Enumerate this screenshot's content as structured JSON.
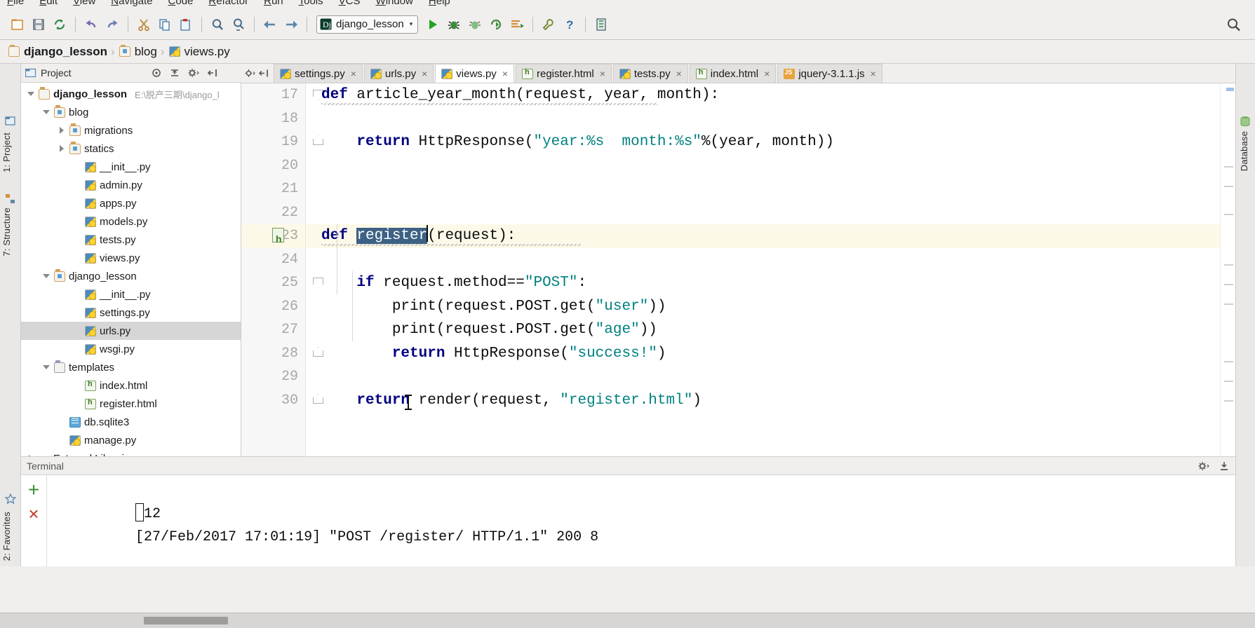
{
  "window": {
    "ide": "PyCharm",
    "accent_blue": "#3d6185",
    "current_line_bg": "#fcf9e8"
  },
  "menubar": {
    "items": [
      "File",
      "Edit",
      "View",
      "Navigate",
      "Code",
      "Refactor",
      "Run",
      "Tools",
      "VCS",
      "Window",
      "Help"
    ]
  },
  "toolbar": {
    "run_config": "django_lesson",
    "run_config_caret": "▾",
    "icons": [
      "open-folder-icon",
      "save-all-icon",
      "sync-icon",
      "undo-icon",
      "redo-icon",
      "cut-icon",
      "copy-icon",
      "paste-icon",
      "find-icon",
      "replace-icon",
      "back-icon",
      "forward-icon"
    ],
    "run_icons": [
      "run-icon",
      "debug-icon",
      "coverage-icon",
      "profile-icon",
      "run-with-console-icon",
      "settings-wrench-icon",
      "help-icon",
      "project-structure-icon"
    ],
    "search_everywhere": "search-everywhere-icon"
  },
  "breadcrumb": {
    "items": [
      {
        "label": "django_lesson",
        "icon": "folder-icon"
      },
      {
        "label": "blog",
        "icon": "module-folder-icon"
      },
      {
        "label": "views.py",
        "icon": "python-file-icon"
      }
    ],
    "separator": "›"
  },
  "left_strip": {
    "tabs": [
      "1: Project",
      "7: Structure",
      "2: Favorites"
    ]
  },
  "right_strip": {
    "tabs": [
      "Database"
    ]
  },
  "project_panel": {
    "title": "Project",
    "caret": "▾",
    "toolbar_icons": [
      "target-icon",
      "collapse-all-icon",
      "gear-icon",
      "hide-icon"
    ],
    "tree": [
      {
        "label": "django_lesson",
        "icon": "folder-icon",
        "depth": 0,
        "arrow": "down",
        "bold": true,
        "path": "E:\\脱产三期\\django_l",
        "selected": false
      },
      {
        "label": "blog",
        "icon": "module-folder-icon",
        "depth": 1,
        "arrow": "down",
        "bold": false,
        "selected": false
      },
      {
        "label": "migrations",
        "icon": "module-folder-icon",
        "depth": 2,
        "arrow": "right",
        "bold": false,
        "selected": false
      },
      {
        "label": "statics",
        "icon": "module-folder-icon",
        "depth": 2,
        "arrow": "right",
        "bold": false,
        "selected": false
      },
      {
        "label": "__init__.py",
        "icon": "python-file-icon",
        "depth": 3,
        "arrow": "none",
        "bold": false,
        "selected": false
      },
      {
        "label": "admin.py",
        "icon": "python-file-icon",
        "depth": 3,
        "arrow": "none",
        "bold": false,
        "selected": false
      },
      {
        "label": "apps.py",
        "icon": "python-file-icon",
        "depth": 3,
        "arrow": "none",
        "bold": false,
        "selected": false
      },
      {
        "label": "models.py",
        "icon": "python-file-icon",
        "depth": 3,
        "arrow": "none",
        "bold": false,
        "selected": false
      },
      {
        "label": "tests.py",
        "icon": "python-file-icon",
        "depth": 3,
        "arrow": "none",
        "bold": false,
        "selected": false
      },
      {
        "label": "views.py",
        "icon": "python-file-icon",
        "depth": 3,
        "arrow": "none",
        "bold": false,
        "selected": false
      },
      {
        "label": "django_lesson",
        "icon": "module-folder-icon",
        "depth": 1,
        "arrow": "down",
        "bold": false,
        "selected": false
      },
      {
        "label": "__init__.py",
        "icon": "python-file-icon",
        "depth": 3,
        "arrow": "none",
        "bold": false,
        "selected": false
      },
      {
        "label": "settings.py",
        "icon": "python-file-icon",
        "depth": 3,
        "arrow": "none",
        "bold": false,
        "selected": false
      },
      {
        "label": "urls.py",
        "icon": "python-file-icon",
        "depth": 3,
        "arrow": "none",
        "bold": false,
        "selected": true
      },
      {
        "label": "wsgi.py",
        "icon": "python-file-icon",
        "depth": 3,
        "arrow": "none",
        "bold": false,
        "selected": false
      },
      {
        "label": "templates",
        "icon": "plain-folder-icon",
        "depth": 1,
        "arrow": "down",
        "bold": false,
        "selected": false
      },
      {
        "label": "index.html",
        "icon": "html-file-icon",
        "depth": 3,
        "arrow": "none",
        "bold": false,
        "selected": false
      },
      {
        "label": "register.html",
        "icon": "html-file-icon",
        "depth": 3,
        "arrow": "none",
        "bold": false,
        "selected": false
      },
      {
        "label": "db.sqlite3",
        "icon": "database-file-icon",
        "depth": 2,
        "arrow": "none",
        "bold": false,
        "selected": false
      },
      {
        "label": "manage.py",
        "icon": "python-file-icon",
        "depth": 2,
        "arrow": "none",
        "bold": false,
        "selected": false
      },
      {
        "label": "External Libraries",
        "icon": "library-icon",
        "depth": 0,
        "arrow": "right",
        "bold": false,
        "selected": false
      }
    ]
  },
  "editor": {
    "tabs": [
      {
        "label": "settings.py",
        "icon": "python-file-icon",
        "active": false,
        "close": "×"
      },
      {
        "label": "urls.py",
        "icon": "python-file-icon",
        "active": false,
        "close": "×"
      },
      {
        "label": "views.py",
        "icon": "python-file-icon",
        "active": true,
        "close": "×"
      },
      {
        "label": "register.html",
        "icon": "html-file-icon",
        "active": false,
        "close": "×"
      },
      {
        "label": "tests.py",
        "icon": "python-file-icon",
        "active": false,
        "close": "×"
      },
      {
        "label": "index.html",
        "icon": "html-file-icon",
        "active": false,
        "close": "×"
      },
      {
        "label": "jquery-3.1.1.js",
        "icon": "js-file-icon",
        "active": false,
        "close": "×"
      }
    ],
    "file": "views.py",
    "first_visible_line": 17,
    "current_line": 23,
    "selected_text": "register",
    "lines": [
      {
        "num": 17,
        "fold": "open",
        "current": false,
        "tokens": [
          {
            "t": "def ",
            "c": "kw"
          },
          {
            "t": "article_year_month(request, year, month):",
            "c": "plain"
          }
        ]
      },
      {
        "num": 18,
        "fold": "none",
        "current": false,
        "tokens": []
      },
      {
        "num": 19,
        "fold": "end",
        "current": false,
        "tokens": [
          {
            "t": "    ",
            "c": "plain"
          },
          {
            "t": "return ",
            "c": "kw"
          },
          {
            "t": "HttpResponse(",
            "c": "plain"
          },
          {
            "t": "\"year:%s  month:%s\"",
            "c": "str"
          },
          {
            "t": "%(year, month))",
            "c": "plain"
          }
        ]
      },
      {
        "num": 20,
        "fold": "none",
        "current": false,
        "tokens": []
      },
      {
        "num": 21,
        "fold": "none",
        "current": false,
        "tokens": []
      },
      {
        "num": 22,
        "fold": "none",
        "current": false,
        "tokens": []
      },
      {
        "num": 23,
        "fold": "open",
        "current": true,
        "gutter_icon": "html-template-icon",
        "tokens": [
          {
            "t": "def ",
            "c": "kw"
          },
          {
            "t": "register",
            "c": "sel"
          },
          {
            "t": "(request):",
            "c": "plain"
          }
        ]
      },
      {
        "num": 24,
        "fold": "none",
        "current": false,
        "tokens": []
      },
      {
        "num": 25,
        "fold": "open",
        "current": false,
        "tokens": [
          {
            "t": "    ",
            "c": "plain"
          },
          {
            "t": "if ",
            "c": "kw"
          },
          {
            "t": "request.method==",
            "c": "plain"
          },
          {
            "t": "\"POST\"",
            "c": "str"
          },
          {
            "t": ":",
            "c": "plain"
          }
        ]
      },
      {
        "num": 26,
        "fold": "none",
        "current": false,
        "tokens": [
          {
            "t": "        print(request.POST.get(",
            "c": "plain"
          },
          {
            "t": "\"user\"",
            "c": "str"
          },
          {
            "t": "))",
            "c": "plain"
          }
        ]
      },
      {
        "num": 27,
        "fold": "none",
        "current": false,
        "tokens": [
          {
            "t": "        print(request.POST.get(",
            "c": "plain"
          },
          {
            "t": "\"age\"",
            "c": "str"
          },
          {
            "t": "))",
            "c": "plain"
          }
        ]
      },
      {
        "num": 28,
        "fold": "end",
        "current": false,
        "tokens": [
          {
            "t": "        ",
            "c": "plain"
          },
          {
            "t": "return ",
            "c": "kw"
          },
          {
            "t": "HttpResponse(",
            "c": "plain"
          },
          {
            "t": "\"success!\"",
            "c": "str"
          },
          {
            "t": ")",
            "c": "plain"
          }
        ]
      },
      {
        "num": 29,
        "fold": "none",
        "current": false,
        "tokens": []
      },
      {
        "num": 30,
        "fold": "end",
        "current": false,
        "tokens": [
          {
            "t": "    ",
            "c": "plain"
          },
          {
            "t": "return ",
            "c": "kw"
          },
          {
            "t": "render(request, ",
            "c": "plain"
          },
          {
            "t": "\"register.html\"",
            "c": "str"
          },
          {
            "t": ")",
            "c": "plain"
          }
        ]
      }
    ]
  },
  "terminal": {
    "title": "Terminal",
    "tools": [
      "gear-icon",
      "hide-icon"
    ],
    "add_button": "+",
    "close_button": "×",
    "lines": [
      "12",
      "[27/Feb/2017 17:01:19] \"POST /register/ HTTP/1.1\" 200 8"
    ]
  }
}
